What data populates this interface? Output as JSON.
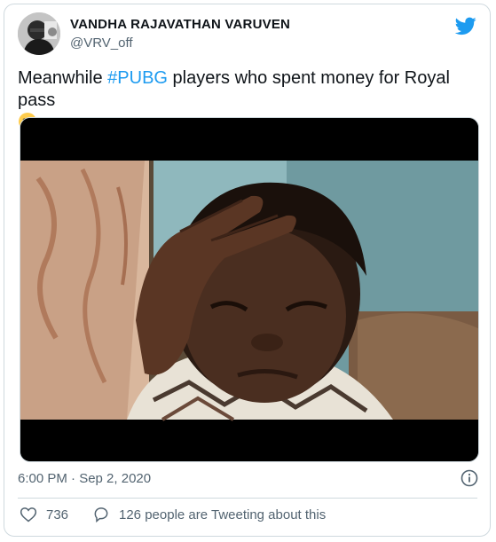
{
  "author": {
    "name": "VANDHA RAJAVATHAN VARUVEN",
    "handle": "@VRV_off",
    "avatar": "profile-photo"
  },
  "brand": {
    "logo": "twitter-bird-icon",
    "color": "#1d9bf0"
  },
  "tweet": {
    "text_before": "Meanwhile ",
    "hashtag": "#PUBG",
    "text_after": " players who spent money for Royal pass",
    "emoji": "crying-face-emoji"
  },
  "media": {
    "description_icon": "meme-photo"
  },
  "meta": {
    "timestamp": "6:00 PM · Sep 2, 2020",
    "info_icon": "info-icon"
  },
  "actions": {
    "like_count": "736",
    "reply_text": "126 people are Tweeting about this"
  },
  "colors": {
    "text": "#0f1419",
    "secondary": "#536471",
    "border": "#cfd9de",
    "link": "#1d9bf0"
  }
}
